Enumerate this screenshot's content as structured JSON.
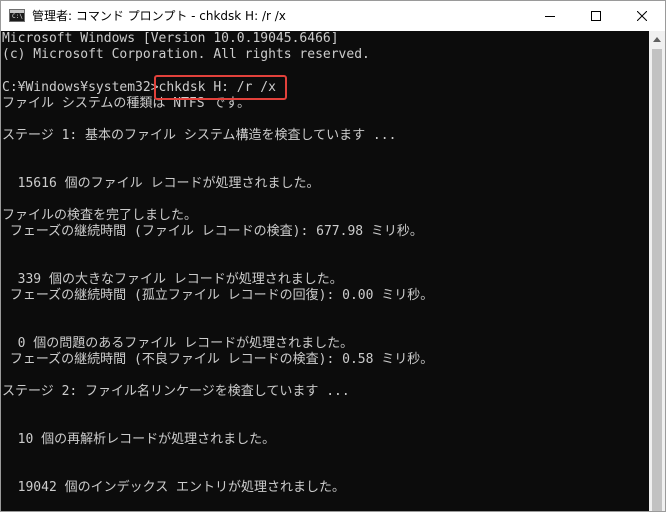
{
  "window": {
    "title": "管理者: コマンド プロンプト - chkdsk  H: /r /x"
  },
  "icons": {
    "app": "command-prompt-icon",
    "minimize": "minimize-icon",
    "maximize": "maximize-icon",
    "close": "close-icon",
    "scroll_up": "scroll-up-arrow-icon"
  },
  "app_icon_text": "C:\\",
  "colors": {
    "console_background": "#0c0c0c",
    "console_text": "#cccccc",
    "highlight_box": "#e2413b"
  },
  "console": {
    "lines": [
      "Microsoft Windows [Version 10.0.19045.6466]",
      "(c) Microsoft Corporation. All rights reserved.",
      "",
      "C:¥Windows¥system32>chkdsk H: /r /x",
      "ファイル システムの種類は NTFS です。",
      "",
      "ステージ 1: 基本のファイル システム構造を検査しています ...",
      "",
      "",
      "  15616 個のファイル レコードが処理されました。",
      "",
      "ファイルの検査を完了しました。",
      " フェーズの継続時間 (ファイル レコードの検査): 677.98 ミリ秒。",
      "",
      "",
      "  339 個の大きなファイル レコードが処理されました。",
      " フェーズの継続時間 (孤立ファイル レコードの回復): 0.00 ミリ秒。",
      "",
      "",
      "  0 個の問題のあるファイル レコードが処理されました。",
      " フェーズの継続時間 (不良ファイル レコードの検査): 0.58 ミリ秒。",
      "",
      "ステージ 2: ファイル名リンケージを検査しています ...",
      "",
      "",
      "  10 個の再解析レコードが処理されました。",
      "",
      "",
      "  19042 個のインデックス エントリが処理されました。"
    ]
  }
}
